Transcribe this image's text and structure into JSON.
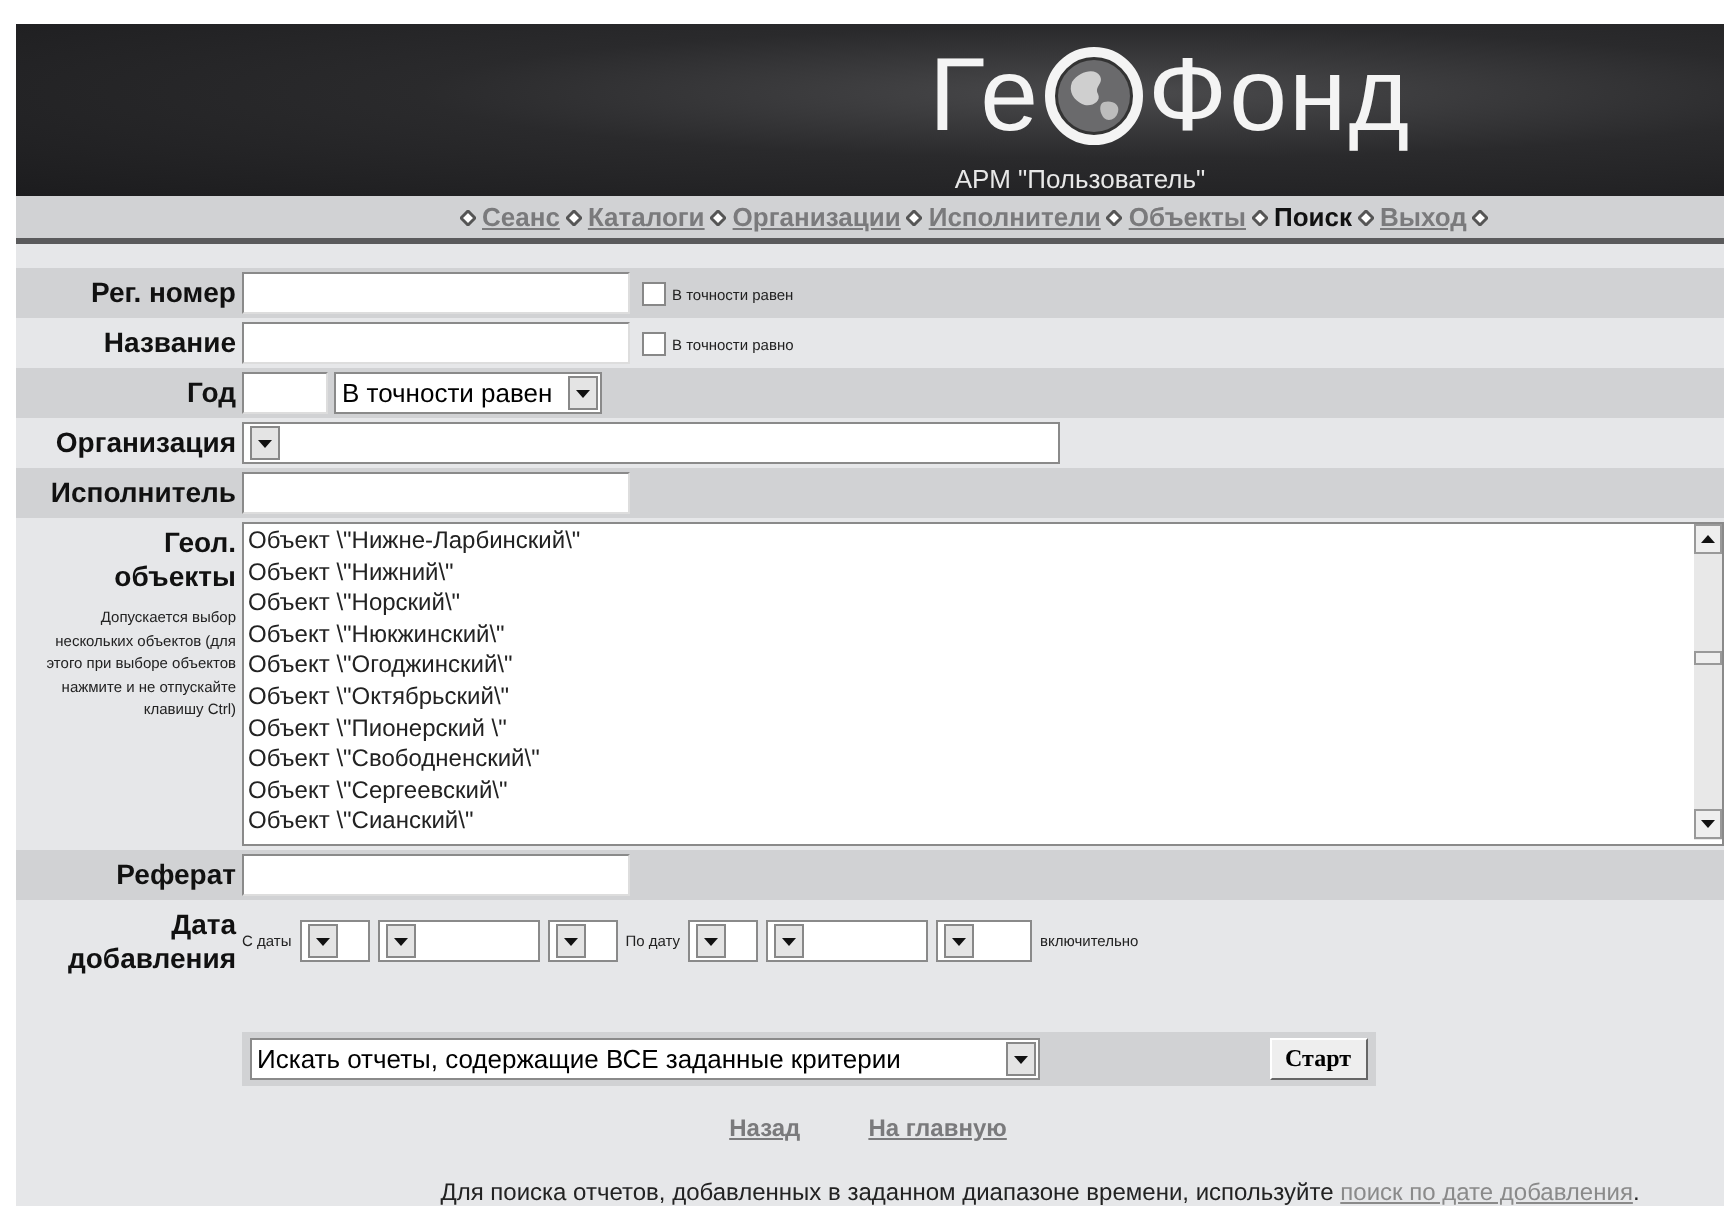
{
  "header": {
    "logo_left": "Ге",
    "logo_right": "Фонд",
    "subtitle": "АРМ \"Пользователь\""
  },
  "nav": [
    {
      "label": "Сеанс",
      "selected": false
    },
    {
      "label": "Каталоги",
      "selected": false
    },
    {
      "label": "Организации",
      "selected": false
    },
    {
      "label": "Исполнители",
      "selected": false
    },
    {
      "label": "Объекты",
      "selected": false
    },
    {
      "label": "Поиск",
      "selected": true
    },
    {
      "label": "Выход",
      "selected": false
    }
  ],
  "fields": [
    {
      "kind": "text",
      "label": "Рег. номер",
      "checkbox": {
        "label": "В точности равен",
        "checked": false
      }
    },
    {
      "kind": "text",
      "label": "Название",
      "checkbox": {
        "label": "В точности равно",
        "checked": false
      }
    },
    {
      "kind": "year",
      "label": "Год",
      "select_value": "В точности равен"
    },
    {
      "kind": "select",
      "label": "Организация"
    },
    {
      "kind": "text",
      "label": "Исполнитель"
    },
    {
      "kind": "list",
      "label": "Геол. объекты",
      "hint": "Допускается выбор нескольких объектов (для этого при выборе объектов нажмите и не отпускайте клавишу Ctrl)",
      "options": [
        "Объект \\\"Нижне-Ларбинский\\\"",
        "Объект \\\"Нижний\\\"",
        "Объект \\\"Норский\\\"",
        "Объект \\\"Нюкжинский\\\"",
        "Объект \\\"Огоджинский\\\"",
        "Объект \\\"Октябрьский\\\"",
        "Объект \\\"Пионерский \\\"",
        "Объект \\\"Свободненский\\\"",
        "Объект \\\"Сергеевский\\\"",
        "Объект \\\"Сианский\\\""
      ]
    },
    {
      "kind": "text",
      "label": "Реферат"
    },
    {
      "kind": "dates",
      "label": "Дата добавления",
      "from_label": "С даты",
      "to_label": "По дату",
      "suffix": "включительно"
    }
  ],
  "search": {
    "mode": "Искать отчеты, содержащие ВСЕ заданные критерии",
    "button": "Старт"
  },
  "links": [
    "Назад",
    "На главную"
  ],
  "footer": {
    "text": "Для поиска отчетов, добавленных в заданном диапазоне времени, используйте",
    "link": "поиск по дате добавления",
    "end": "."
  }
}
